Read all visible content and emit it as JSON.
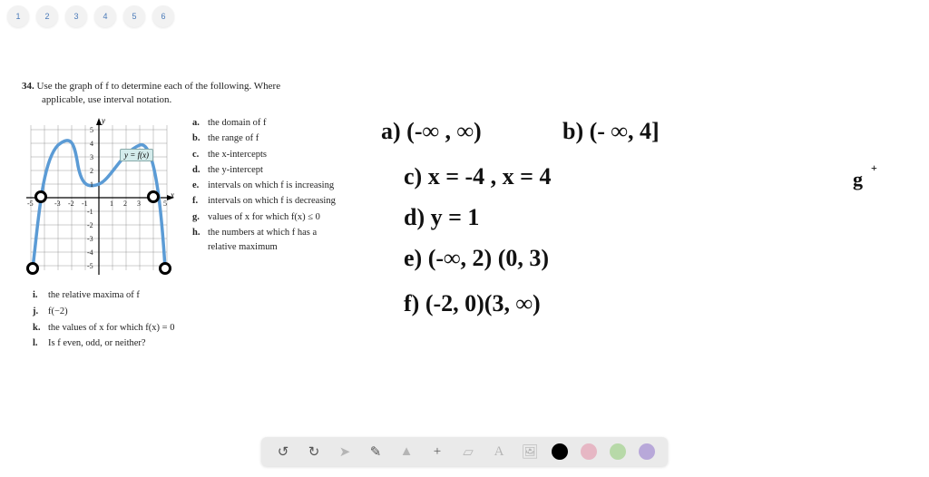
{
  "pages": [
    "1",
    "2",
    "3",
    "4",
    "5",
    "6"
  ],
  "question": {
    "num": "34.",
    "line1": "Use the graph of f to determine each of the following. Where",
    "line2": "applicable, use interval notation."
  },
  "graph": {
    "ylabel": "y",
    "xlabel": "x",
    "eq": "y = f(x)",
    "ticks_x_neg": "-5",
    "ticks_x_pos": "5",
    "tick_x_n3": "-3",
    "tick_x_n2": "-2",
    "tick_x_n1": "-1",
    "tick_x_1": "1",
    "tick_x_2": "2",
    "tick_x_3": "3",
    "tick_y_5": "5",
    "tick_y_4": "4",
    "tick_y_3": "3",
    "tick_y_2": "2",
    "tick_y_1": "1",
    "tick_y_n1": "-1",
    "tick_y_n2": "-2",
    "tick_y_n3": "-3",
    "tick_y_n4": "-4",
    "tick_y_n5": "-5"
  },
  "subs": {
    "a": "the domain of f",
    "b": "the range of f",
    "c": "the x-intercepts",
    "d": "the y-intercept",
    "e": "intervals on which f is increasing",
    "f": "intervals on which f is decreasing",
    "g": "values of x for which f(x) ≤ 0",
    "h": "the numbers at which f has a relative maximum"
  },
  "lower": {
    "i": "the relative maxima of f",
    "j": "f(−2)",
    "k": "the values of x for which f(x) = 0",
    "l": "Is f even, odd, or neither?"
  },
  "hand": {
    "a": "a) (-∞ , ∞)",
    "b": "b) (- ∞, 4]",
    "c": "c) x = -4 , x = 4",
    "d": "d) y = 1",
    "e": "e) (-∞, 2) (0, 3)",
    "f": "f) (-2, 0)(3, ∞)",
    "g": "g"
  },
  "toolbar": {
    "undo": "↺",
    "redo": "↻",
    "pointer": "➤",
    "pen": "✎",
    "shapes": "▲",
    "plus": "+",
    "eraser": "▱",
    "text": "A",
    "image": "🖼"
  }
}
